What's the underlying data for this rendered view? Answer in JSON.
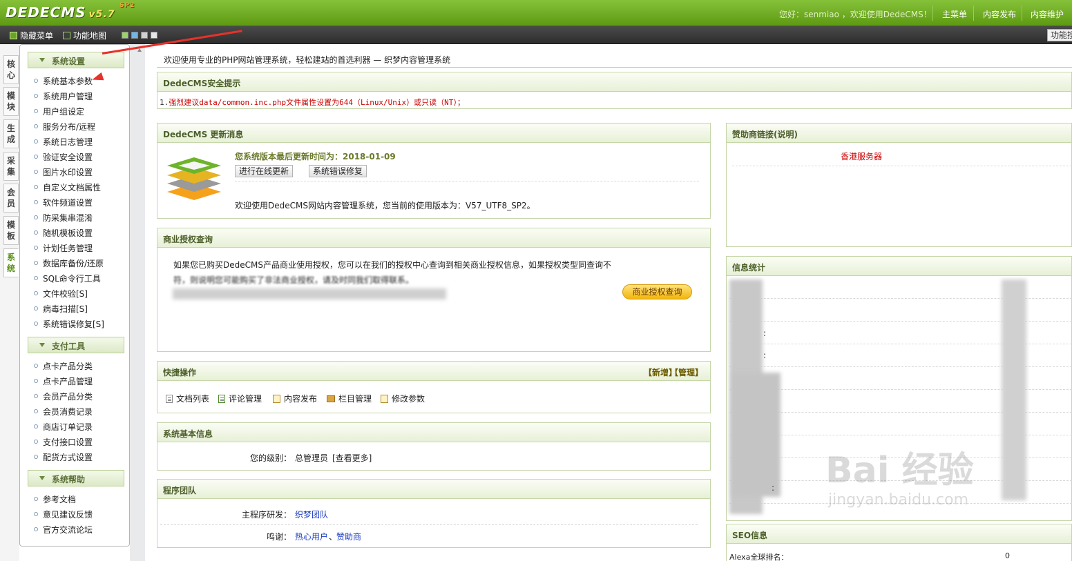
{
  "header": {
    "logo": "DEDECMS",
    "version": "v5.7",
    "sp": "SP2",
    "welcome": "您好：senmiao ，欢迎使用DedeCMS！",
    "nav": [
      "主菜单",
      "内容发布",
      "内容维护"
    ]
  },
  "toolbar": {
    "hide_menu": "隐藏菜单",
    "func_map": "功能地图",
    "func_search": "功能搜"
  },
  "vtabs": [
    "核心",
    "模块",
    "生成",
    "采集",
    "会员",
    "模板",
    "系统"
  ],
  "sidebar": {
    "groups": [
      {
        "title": "系统设置",
        "items": [
          "系统基本参数",
          "系统用户管理",
          "用户组设定",
          "服务分布/远程",
          "系统日志管理",
          "验证安全设置",
          "图片水印设置",
          "自定义文档属性",
          "软件频道设置",
          "防采集串混淆",
          "随机模板设置",
          "计划任务管理",
          "数据库备份/还原",
          "SQL命令行工具",
          "文件校验[S]",
          "病毒扫描[S]",
          "系统错误修复[S]"
        ]
      },
      {
        "title": "支付工具",
        "items": [
          "点卡产品分类",
          "点卡产品管理",
          "会员产品分类",
          "会员消费记录",
          "商店订单记录",
          "支付接口设置",
          "配货方式设置"
        ]
      },
      {
        "title": "系统帮助",
        "items": [
          "参考文档",
          "意见建议反馈",
          "官方交流论坛"
        ]
      }
    ]
  },
  "main": {
    "intro": "欢迎使用专业的PHP网站管理系统，轻松建站的首选利器 — 织梦内容管理系统",
    "security": {
      "title": "DedeCMS安全提示",
      "num": "1.",
      "text": "强烈建议data/common.inc.php文件属性设置为644（Linux/Unix）或只读（NT）；"
    },
    "update": {
      "title": "DedeCMS 更新消息",
      "last_update": "您系统版本最后更新时间为：2018-01-09",
      "btn_online": "进行在线更新",
      "btn_fix": "系统错误修复",
      "welcome": "欢迎使用DedeCMS网站内容管理系统，您当前的使用版本为：V57_UTF8_SP2。"
    },
    "license": {
      "title": "商业授权查询",
      "text1": "如果您已购买DedeCMS产品商业使用授权，您可以在我们的授权中心查询到相关商业授权信息，如果授权类型同查询不",
      "text2": "符，则说明您可能购买了非法商业授权，请及时同我们取得联系。",
      "btn": "商业授权查询"
    },
    "quick": {
      "title": "快捷操作",
      "add": "【新增】",
      "manage": "【管理】",
      "items": [
        "文档列表",
        "评论管理",
        "内容发布",
        "栏目管理",
        "修改参数"
      ]
    },
    "sysinfo": {
      "title": "系统基本信息",
      "level_label": "您的级别：",
      "level_value": "总管理员",
      "more": "[查看更多]"
    },
    "team": {
      "title": "程序团队",
      "dev_label": "主程序研发：",
      "dev_value": "织梦团队",
      "thanks_label": "鸣谢：",
      "thanks_users": "热心用户",
      "thanks_sep": "、",
      "thanks_sponsor": "赞助商"
    }
  },
  "right": {
    "sponsor": {
      "title": "赞助商链接(说明)",
      "link": "香港服务器"
    },
    "stats": {
      "title": "信息统计",
      "colons": [
        ":",
        ":",
        ":"
      ]
    },
    "seo": {
      "title": "SEO信息",
      "alexa_label": "Alexa全球排名：",
      "alexa_value": "0"
    }
  },
  "watermark": {
    "main": "Bai 经验",
    "sub": "jingyan.baidu.com"
  }
}
